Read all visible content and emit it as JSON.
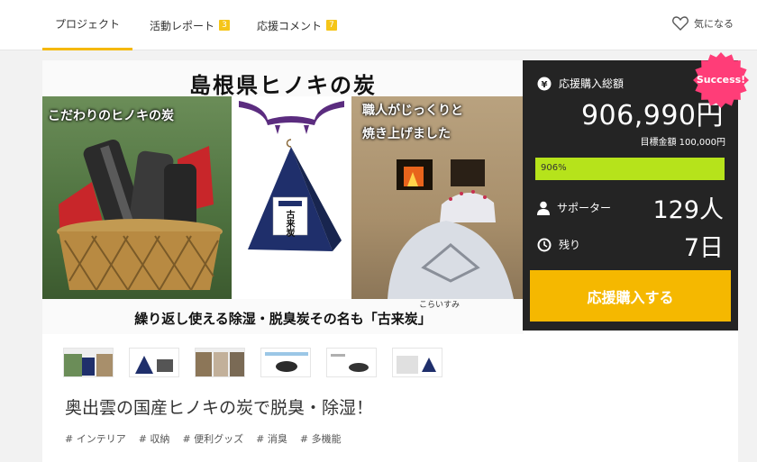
{
  "nav": {
    "tabs": [
      {
        "label": "プロジェクト",
        "badge": ""
      },
      {
        "label": "活動レポート",
        "badge": "3"
      },
      {
        "label": "応援コメント",
        "badge": "7"
      }
    ],
    "favorite_label": "気になる"
  },
  "hero": {
    "title": "島根県ヒノキの炭",
    "caption_left": "こだわりのヒノキの炭",
    "caption_right_1": "職人がじっくりと",
    "caption_right_2": "焼き上げました",
    "bag_label": "古来炭",
    "subtitle": "繰り返し使える除湿・脱臭炭その名も「古来炭」",
    "ruby": "こらいすみ"
  },
  "project": {
    "title": "奥出雲の国産ヒノキの炭で脱臭・除湿！",
    "tags": [
      "# インテリア",
      "# 収納",
      "# 便利グッズ",
      "# 消臭",
      "# 多機能"
    ]
  },
  "funding": {
    "total_label": "応援購入総額",
    "amount": "906,990円",
    "goal": "目標金額 100,000円",
    "progress_text": "906%",
    "progress_fraction": 1.0,
    "supporters_label": "サポーター",
    "supporters": "129人",
    "remaining_label": "残り",
    "remaining": "7日",
    "buy_button": "応援購入する",
    "status_badge": "Success!"
  },
  "colors": {
    "accent": "#f5b800",
    "progress": "#b6e31b",
    "panel": "#242424",
    "badge": "#ff3d78"
  }
}
